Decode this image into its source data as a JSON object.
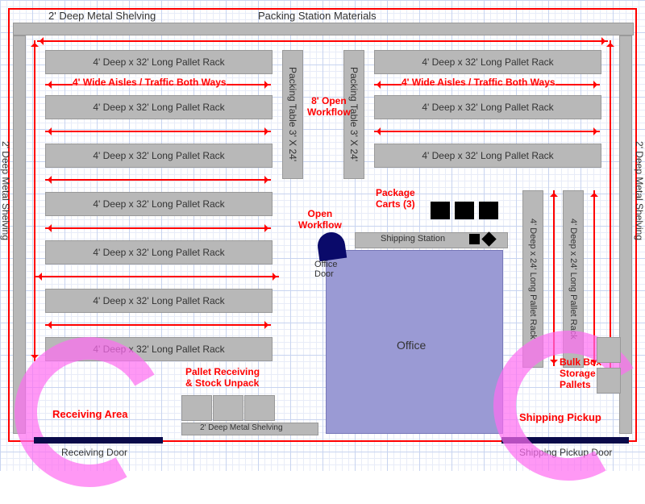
{
  "top": {
    "shelving": "2' Deep Metal Shelving",
    "materials": "Packing Station Materials"
  },
  "side": {
    "shelving": "2' Deep Metal Shelving"
  },
  "rack": {
    "long": "4' Deep x 32' Long Pallet Rack",
    "short": "4' Deep x 24' Long Pallet Rack"
  },
  "aisle": "4' Wide Aisles / Traffic Both Ways",
  "packing": {
    "table": "Packing Table 3' X 24'",
    "workflow": "8' Open\nWorkflow",
    "open": "Open\nWorkflow"
  },
  "shipping": {
    "station": "Shipping Station",
    "pickup": "Shipping Pickup",
    "door": "Shipping Pickup Door",
    "carts": "Package\nCarts (3)"
  },
  "office": {
    "label": "Office",
    "door": "Office\nDoor"
  },
  "receiving": {
    "area": "Receiving Area",
    "door": "Receiving Door",
    "pallet": "Pallet Receiving\n& Stock Unpack",
    "shelving": "2' Deep Metal Shelving"
  },
  "bulk": "Bulk Box\nStorage\nPallets"
}
